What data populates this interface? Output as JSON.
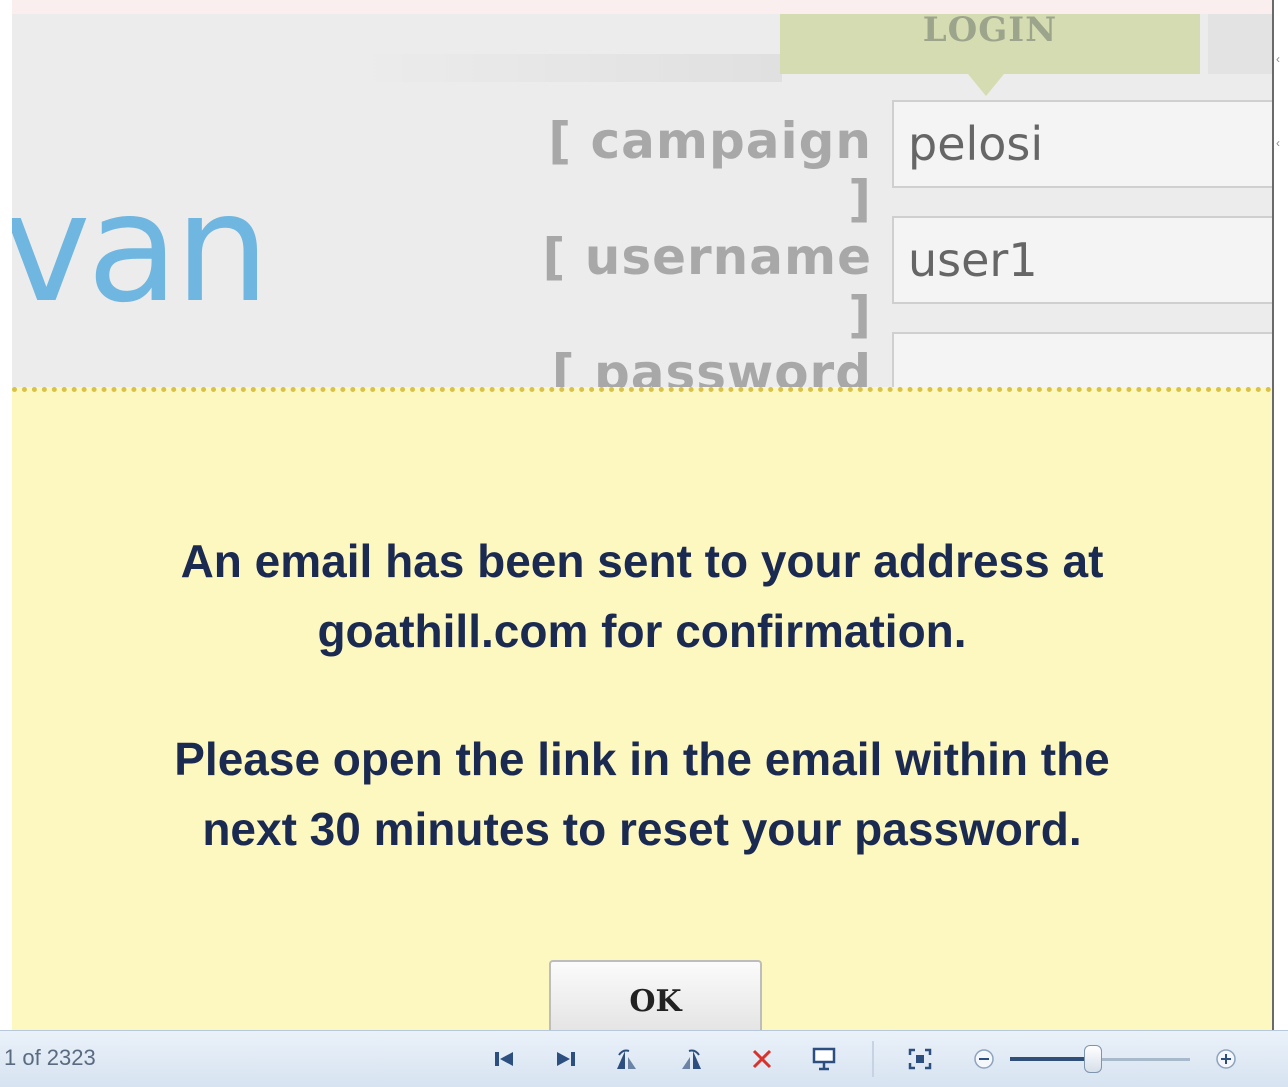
{
  "login_tab": {
    "label": "LOGIN"
  },
  "logo": {
    "text": "van"
  },
  "form": {
    "campaign": {
      "label": "[ campaign ]",
      "value": "pelosi"
    },
    "username": {
      "label": "[ username ]",
      "value": "user1"
    },
    "password": {
      "label": "[ password ]",
      "value": ""
    }
  },
  "notice": {
    "line1": "An email has been sent to your address at",
    "line2": "goathill.com for confirmation.",
    "line3": "Please open the link in the email within the",
    "line4": "next 30 minutes to reset your password.",
    "ok_label": "OK"
  },
  "viewer": {
    "counter": "1 of 2323",
    "buttons": [
      "previous-icon",
      "next-icon",
      "rotate-left-icon",
      "rotate-right-icon",
      "delete-icon",
      "slideshow-icon",
      "actual-size-icon",
      "zoom-out-icon",
      "zoom-in-icon"
    ],
    "accent_color": "#2d4f80",
    "delete_color": "#d9322c"
  }
}
